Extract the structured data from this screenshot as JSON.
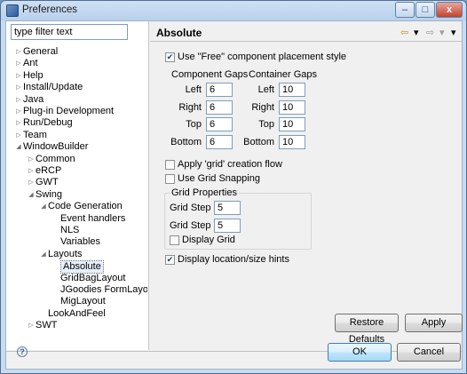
{
  "window": {
    "title": "Preferences",
    "min_label": "–",
    "max_label": "□",
    "close_label": "x"
  },
  "filter": {
    "value": "type filter text"
  },
  "tree": [
    {
      "label": "General",
      "indent": 0,
      "twisty": "▷"
    },
    {
      "label": "Ant",
      "indent": 0,
      "twisty": "▷"
    },
    {
      "label": "Help",
      "indent": 0,
      "twisty": "▷"
    },
    {
      "label": "Install/Update",
      "indent": 0,
      "twisty": "▷"
    },
    {
      "label": "Java",
      "indent": 0,
      "twisty": "▷"
    },
    {
      "label": "Plug-in Development",
      "indent": 0,
      "twisty": "▷"
    },
    {
      "label": "Run/Debug",
      "indent": 0,
      "twisty": "▷"
    },
    {
      "label": "Team",
      "indent": 0,
      "twisty": "▷"
    },
    {
      "label": "WindowBuilder",
      "indent": 0,
      "twisty": "◢"
    },
    {
      "label": "Common",
      "indent": 1,
      "twisty": "▷"
    },
    {
      "label": "eRCP",
      "indent": 1,
      "twisty": "▷"
    },
    {
      "label": "GWT",
      "indent": 1,
      "twisty": "▷"
    },
    {
      "label": "Swing",
      "indent": 1,
      "twisty": "◢"
    },
    {
      "label": "Code Generation",
      "indent": 2,
      "twisty": "◢"
    },
    {
      "label": "Event handlers",
      "indent": 3,
      "twisty": ""
    },
    {
      "label": "NLS",
      "indent": 3,
      "twisty": ""
    },
    {
      "label": "Variables",
      "indent": 3,
      "twisty": ""
    },
    {
      "label": "Layouts",
      "indent": 2,
      "twisty": "◢"
    },
    {
      "label": "Absolute",
      "indent": 3,
      "twisty": "",
      "selected": true
    },
    {
      "label": "GridBagLayout",
      "indent": 3,
      "twisty": ""
    },
    {
      "label": "JGoodies FormLayout",
      "indent": 3,
      "twisty": ""
    },
    {
      "label": "MigLayout",
      "indent": 3,
      "twisty": ""
    },
    {
      "label": "LookAndFeel",
      "indent": 2,
      "twisty": ""
    },
    {
      "label": "SWT",
      "indent": 1,
      "twisty": "▷"
    }
  ],
  "page": {
    "title": "Absolute",
    "nav_back": "⇦",
    "nav_back_menu": "▾",
    "nav_forward": "⇨",
    "nav_forward_menu": "▾",
    "view_menu": "▾",
    "use_free_label": "Use \"Free\" component placement style",
    "use_free_checked": true,
    "component_gaps": {
      "title": "Component Gaps",
      "left_label": "Left",
      "left": "6",
      "right_label": "Right",
      "right": "6",
      "top_label": "Top",
      "top": "6",
      "bottom_label": "Bottom",
      "bottom": "6"
    },
    "container_gaps": {
      "title": "Container Gaps",
      "left_label": "Left",
      "left": "10",
      "right_label": "Right",
      "right": "10",
      "top_label": "Top",
      "top": "10",
      "bottom_label": "Bottom",
      "bottom": "10"
    },
    "apply_grid_label": "Apply 'grid' creation flow",
    "apply_grid_checked": false,
    "use_grid_snapping_label": "Use Grid Snapping",
    "use_grid_snapping_checked": false,
    "grid_properties": {
      "title": "Grid Properties",
      "step_x_label": "Grid Step X",
      "step_x": "5",
      "step_y_label": "Grid Step Y",
      "step_y": "5",
      "display_grid_label": "Display Grid",
      "display_grid_checked": false
    },
    "display_hints_label": "Display location/size hints",
    "display_hints_checked": true,
    "restore_defaults": "Restore Defaults",
    "apply": "Apply"
  },
  "footer": {
    "help": "?",
    "ok": "OK",
    "cancel": "Cancel"
  }
}
